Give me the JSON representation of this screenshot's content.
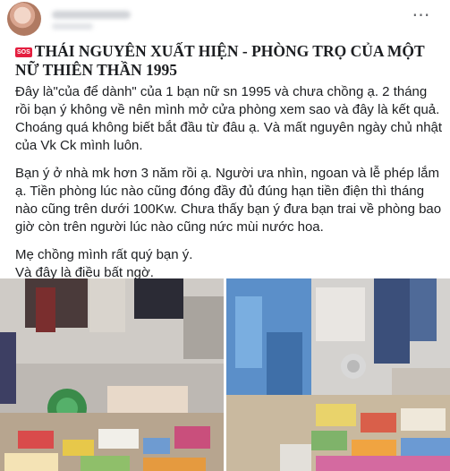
{
  "post": {
    "more_label": "⋯",
    "title_badge": "SOS",
    "title": "THÁI NGUYÊN XUẤT HIỆN - PHÒNG TRỌ CỦA MỘT NỮ THIÊN THẦN 1995",
    "paragraphs": [
      "Đây là\"của để dành\" của 1 bạn nữ sn 1995 và chưa chồng ạ. 2 tháng rồi bạn ý không về nên mình mở cửa phòng xem sao và đây là kết quả. Choáng quá không biết bắt đầu từ đâu ạ. Và mất nguyên ngày chủ nhật của Vk Ck mình luôn.",
      "Bạn ý ở nhà mk hơn 3 năm rồi ạ. Người ưa nhìn, ngoan và lễ phép lắm ạ. Tiền phòng lúc nào cũng đóng đầy đủ đúng hạn tiền điện thì tháng nào cũng trên dưới 100Kw. Chưa thấy bạn ý đưa bạn trai về phòng bao giờ còn trên người lúc nào cũng nức mùi nước hoa.",
      "Mẹ chồng mình rất quý bạn ý.",
      "Và đây là điều bất ngờ."
    ]
  },
  "icons": {
    "more": "more-horizontal-icon",
    "badge": "sos-icon"
  },
  "colors": {
    "text": "#1c1e21",
    "secondary": "#65676b",
    "badge_red": "#e41e3f"
  }
}
